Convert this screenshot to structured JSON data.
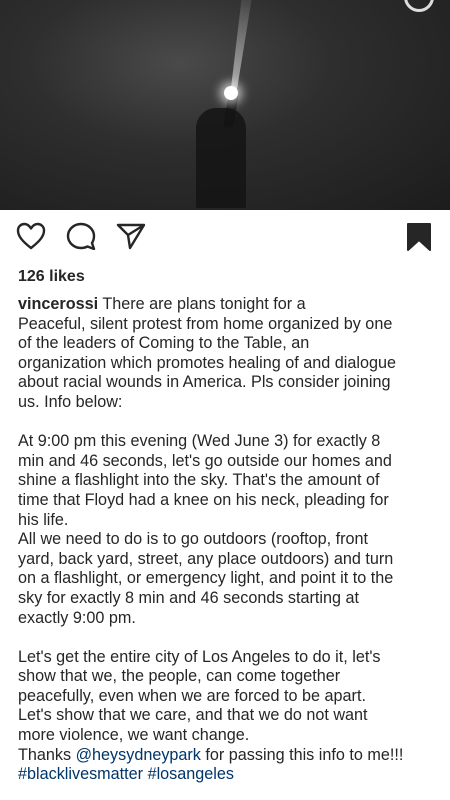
{
  "post": {
    "likes": "126 likes",
    "username": "vincerossi",
    "caption_first": "There are plans tonight for a",
    "caption_lines_1": [
      "Peaceful, silent protest from home organized by one",
      "of the leaders of Coming to the Table, an",
      "organization which promotes healing of and dialogue",
      "about racial wounds in America.  Pls consider joining",
      "us.  Info below:"
    ],
    "caption_lines_2": [
      "At 9:00 pm this evening (Wed June 3) for exactly 8",
      "min and 46 seconds, let's go outside our homes and",
      "shine a flashlight into the sky. That's the amount of",
      "time that Floyd had a knee on his neck, pleading for",
      "his life.",
      "All we need to do is to go outdoors (rooftop, front",
      "yard, back yard, street, any place outdoors) and turn",
      "on a flashlight, or emergency light, and point it to the",
      "sky for exactly 8 min and 46 seconds starting at",
      "exactly 9:00 pm."
    ],
    "caption_lines_3": [
      "Let's get the entire city of Los Angeles to do it, let's",
      "show that we, the people, can come together",
      "peacefully, even when we are forced to be apart.",
      "Let's show that we care, and that we do not want",
      "more violence, we want change."
    ],
    "thanks_prefix": "Thanks ",
    "mention": "@heysydneypark",
    "thanks_suffix": " for passing this info to me!!!",
    "hashtag_1": "#blacklivesmatter",
    "hashtag_2": "#losangeles"
  },
  "icons": {
    "like": "heart-icon",
    "comment": "comment-icon",
    "share": "send-icon",
    "save": "bookmark-icon"
  },
  "colors": {
    "text": "#262626",
    "link": "#003569",
    "background": "#ffffff"
  }
}
